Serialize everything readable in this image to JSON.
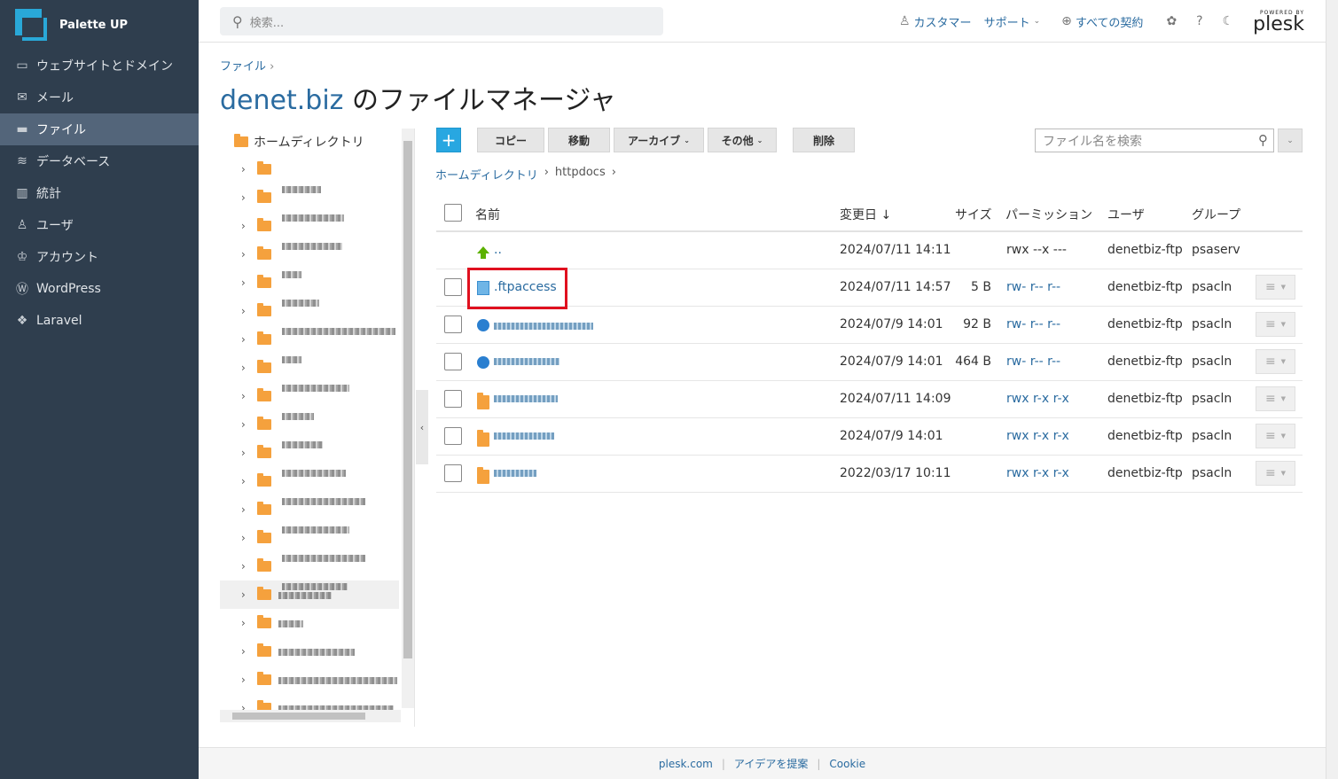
{
  "brand": {
    "name": "Palette UP"
  },
  "nav": [
    {
      "label": "ウェブサイトとドメイン",
      "icon": "monitor-icon"
    },
    {
      "label": "メール",
      "icon": "mail-icon"
    },
    {
      "label": "ファイル",
      "icon": "folder-icon",
      "active": true
    },
    {
      "label": "データベース",
      "icon": "database-icon"
    },
    {
      "label": "統計",
      "icon": "chart-icon"
    },
    {
      "label": "ユーザ",
      "icon": "user-icon"
    },
    {
      "label": "アカウント",
      "icon": "account-icon"
    },
    {
      "label": "WordPress",
      "icon": "wordpress-icon"
    },
    {
      "label": "Laravel",
      "icon": "laravel-icon"
    }
  ],
  "topbar": {
    "search_placeholder": "検索...",
    "customer": "カスタマー",
    "support": "サポート",
    "subscriptions": "すべての契約",
    "powered_by": "POWERED BY",
    "logo": "plesk"
  },
  "breadcrumb": {
    "root": "ファイル"
  },
  "title": {
    "domain": "denet.biz",
    "suffix": " のファイルマネージャ"
  },
  "tree": {
    "root": "ホームディレクトリ",
    "last_visible": "wordpress-backups"
  },
  "toolbar": {
    "add": "+",
    "copy": "コピー",
    "move": "移動",
    "archive": "アーカイブ",
    "other": "その他",
    "delete": "削除",
    "file_search_placeholder": "ファイル名を検索"
  },
  "path": {
    "home": "ホームディレクトリ",
    "current": "httpdocs"
  },
  "table": {
    "headers": {
      "name": "名前",
      "modified": "変更日 ↓",
      "size": "サイズ",
      "permission": "パーミッション",
      "user": "ユーザ",
      "group": "グループ"
    },
    "rows": [
      {
        "name": "..",
        "date": "2024/07/11 14:11",
        "size": "",
        "perm": "rwx --x ---",
        "user": "denetbiz-ftp",
        "group": "psaserv",
        "type": "up"
      },
      {
        "name": ".ftpaccess",
        "date": "2024/07/11 14:57",
        "size": "5 B",
        "perm": "rw- r-- r--",
        "user": "denetbiz-ftp",
        "group": "psacln",
        "type": "doc"
      },
      {
        "name": "",
        "date": "2024/07/9 14:01",
        "size": "92 B",
        "perm": "rw- r-- r--",
        "user": "denetbiz-ftp",
        "group": "psacln",
        "type": "web"
      },
      {
        "name": "",
        "date": "2024/07/9 14:01",
        "size": "464 B",
        "perm": "rw- r-- r--",
        "user": "denetbiz-ftp",
        "group": "psacln",
        "type": "web"
      },
      {
        "name": "",
        "date": "2024/07/11 14:09",
        "size": "",
        "perm": "rwx r-x r-x",
        "user": "denetbiz-ftp",
        "group": "psacln",
        "type": "folder"
      },
      {
        "name": "",
        "date": "2024/07/9 14:01",
        "size": "",
        "perm": "rwx r-x r-x",
        "user": "denetbiz-ftp",
        "group": "psacln",
        "type": "folder"
      },
      {
        "name": "",
        "date": "2022/03/17 10:11",
        "size": "",
        "perm": "rwx r-x r-x",
        "user": "denetbiz-ftp",
        "group": "psacln",
        "type": "folder"
      }
    ]
  },
  "footer": {
    "link1": "plesk.com",
    "link2": "アイデアを提案",
    "link3": "Cookie"
  },
  "colors": {
    "sidebar": "#2f3e4e",
    "accent": "#28a7e1",
    "link": "#2a6ba0",
    "highlight": "#e0101f"
  }
}
